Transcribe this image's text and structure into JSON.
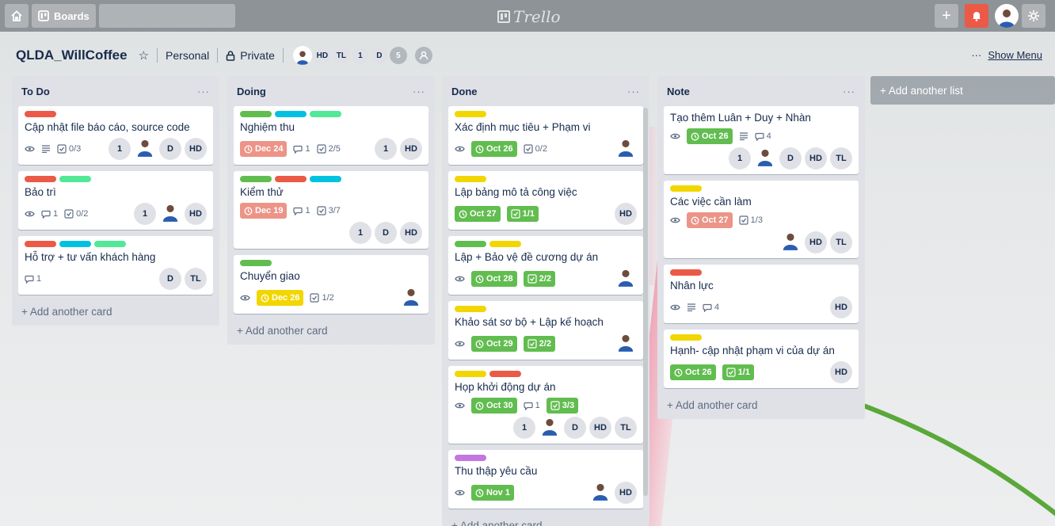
{
  "header": {
    "boards_label": "Boards",
    "search_placeholder": "",
    "logo_text": "Trello"
  },
  "board": {
    "title": "QLDA_WillCoffee",
    "team": "Personal",
    "visibility": "Private",
    "members": [
      "HD",
      "TL",
      "1",
      "D",
      "5"
    ],
    "show_menu": "Show Menu",
    "menu_dots": "···"
  },
  "colors": {
    "red": "#eb5a46",
    "green": "#61bd4f",
    "yellow": "#f2d600",
    "blue": "#00c2e0",
    "lime": "#51e898",
    "purple": "#c377e0",
    "orange": "#ff9f1a"
  },
  "lists": [
    {
      "title": "To Do",
      "add_card": "+ Add another card",
      "cards": [
        {
          "labels": [
            "red"
          ],
          "title": "Cập nhật file báo cáo, source code",
          "watch": true,
          "desc": true,
          "checklist": "0/3",
          "members": [
            "1",
            "photo",
            "D",
            "HD"
          ]
        },
        {
          "labels": [
            "red",
            "lime"
          ],
          "title": "Bảo trì",
          "watch": true,
          "comments": "1",
          "checklist": "0/2",
          "members": [
            "1",
            "photo",
            "HD"
          ]
        },
        {
          "labels": [
            "red",
            "blue",
            "lime"
          ],
          "title": "Hỗ trợ + tư vấn khách hàng",
          "comments": "1",
          "members": [
            "D",
            "TL"
          ]
        }
      ]
    },
    {
      "title": "Doing",
      "add_card": "+ Add another card",
      "cards": [
        {
          "labels": [
            "green",
            "blue",
            "lime"
          ],
          "title": "Nghiệm thu",
          "due": "Dec 24",
          "due_color": "red",
          "comments": "1",
          "checklist": "2/5",
          "members": [
            "1",
            "HD"
          ]
        },
        {
          "labels": [
            "green",
            "red",
            "blue"
          ],
          "title": "Kiểm thử",
          "due": "Dec 19",
          "due_color": "red",
          "comments": "1",
          "checklist": "3/7",
          "members_row": [
            "1",
            "D",
            "HD"
          ]
        },
        {
          "labels": [
            "green"
          ],
          "title": "Chuyển giao",
          "watch": true,
          "due": "Dec 26",
          "due_color": "yellow",
          "checklist": "1/2",
          "members": [
            "photo"
          ]
        }
      ]
    },
    {
      "title": "Done",
      "add_card": "+ Add another card",
      "cards": [
        {
          "labels": [
            "yellow"
          ],
          "title": "Xác định mục tiêu + Phạm vi",
          "watch": true,
          "due": "Oct 26",
          "due_color": "green",
          "checklist": "0/2",
          "members": [
            "photo"
          ]
        },
        {
          "labels": [
            "yellow"
          ],
          "title": "Lập bảng mô tả công việc",
          "due": "Oct 27",
          "due_color": "green",
          "checklist": "1/1",
          "checklist_done": true,
          "members": [
            "HD"
          ]
        },
        {
          "labels": [
            "green",
            "yellow"
          ],
          "title": "Lập + Bảo vệ đề cương dự án",
          "watch": true,
          "due": "Oct 28",
          "due_color": "green",
          "checklist": "2/2",
          "checklist_done": true,
          "members": [
            "photo"
          ]
        },
        {
          "labels": [
            "yellow"
          ],
          "title": "Khảo sát sơ bộ + Lập kế hoạch",
          "watch": true,
          "due": "Oct 29",
          "due_color": "green",
          "checklist": "2/2",
          "checklist_done": true,
          "members": [
            "photo"
          ]
        },
        {
          "labels": [
            "yellow",
            "red"
          ],
          "title": "Họp khởi động dự án",
          "watch": true,
          "due": "Oct 30",
          "due_color": "green",
          "comments": "1",
          "checklist": "3/3",
          "checklist_done": true,
          "members_row": [
            "1",
            "photo",
            "D",
            "HD",
            "TL"
          ]
        },
        {
          "labels": [
            "purple"
          ],
          "title": "Thu thập yêu cầu",
          "watch": true,
          "due": "Nov 1",
          "due_color": "green",
          "members": [
            "photo",
            "HD"
          ]
        }
      ]
    },
    {
      "title": "Note",
      "add_card": "+ Add another card",
      "cards": [
        {
          "labels": [],
          "title": "Tạo thêm Luân + Duy + Nhàn",
          "watch": true,
          "due": "Oct 26",
          "due_color": "green",
          "desc": true,
          "comments": "4",
          "members_row": [
            "1",
            "photo",
            "D",
            "HD",
            "TL"
          ]
        },
        {
          "labels": [
            "yellow"
          ],
          "title": "Các việc cần làm",
          "watch": true,
          "due": "Oct 27",
          "due_color": "red",
          "checklist": "1/3",
          "members_row": [
            "photo",
            "HD",
            "TL"
          ]
        },
        {
          "labels": [
            "red"
          ],
          "title": "Nhân lực",
          "watch": true,
          "desc": true,
          "comments": "4",
          "members": [
            "HD"
          ]
        },
        {
          "labels": [
            "yellow"
          ],
          "title": "Hạnh- cập nhật phạm vi của dự án",
          "due": "Oct 26",
          "due_color": "green",
          "checklist": "1/1",
          "checklist_done": true,
          "members": [
            "HD"
          ]
        }
      ]
    }
  ],
  "add_list": "+ Add another list"
}
